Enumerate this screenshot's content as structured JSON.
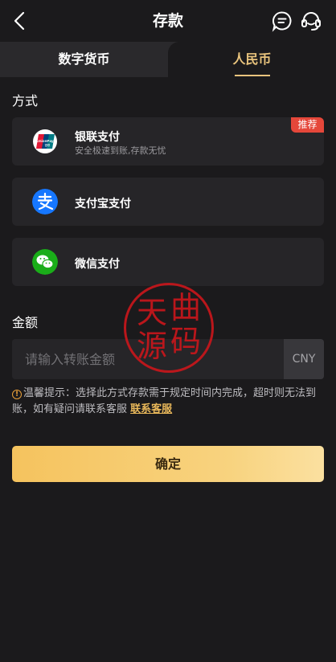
{
  "header": {
    "title": "存款",
    "back_icon": "chevron-left-icon",
    "chat_icon": "chat-bubble-icon",
    "service_icon": "headset-icon"
  },
  "tabs": [
    {
      "label": "数字货币",
      "active": false
    },
    {
      "label": "人民币",
      "active": true
    }
  ],
  "method_section": {
    "label": "方式",
    "items": [
      {
        "name": "银联支付",
        "desc": "安全极速到账,存款无忧",
        "badge": "推荐",
        "icon": "unionpay-logo",
        "logo_text": "UnionPay",
        "logo_subtext": "银联"
      },
      {
        "name": "支付宝支付",
        "desc": "",
        "icon": "alipay-icon"
      },
      {
        "name": "微信支付",
        "desc": "",
        "icon": "wechat-icon"
      }
    ]
  },
  "amount_section": {
    "label": "金额",
    "placeholder": "请输入转账金额",
    "currency": "CNY"
  },
  "tip": {
    "text": "温馨提示：选择此方式存款需于规定时间内完成，超时则无法到账，如有疑问请联系客服 ",
    "link": "联系客服"
  },
  "confirm_label": "确定",
  "watermark": {
    "chars": [
      "天",
      "曲",
      "源",
      "码"
    ]
  },
  "colors": {
    "background": "#1b1a1c",
    "card": "#262528",
    "accent_gold": "#e9c47d",
    "badge_red": "#e5473a",
    "stamp_red": "#c8161b"
  }
}
